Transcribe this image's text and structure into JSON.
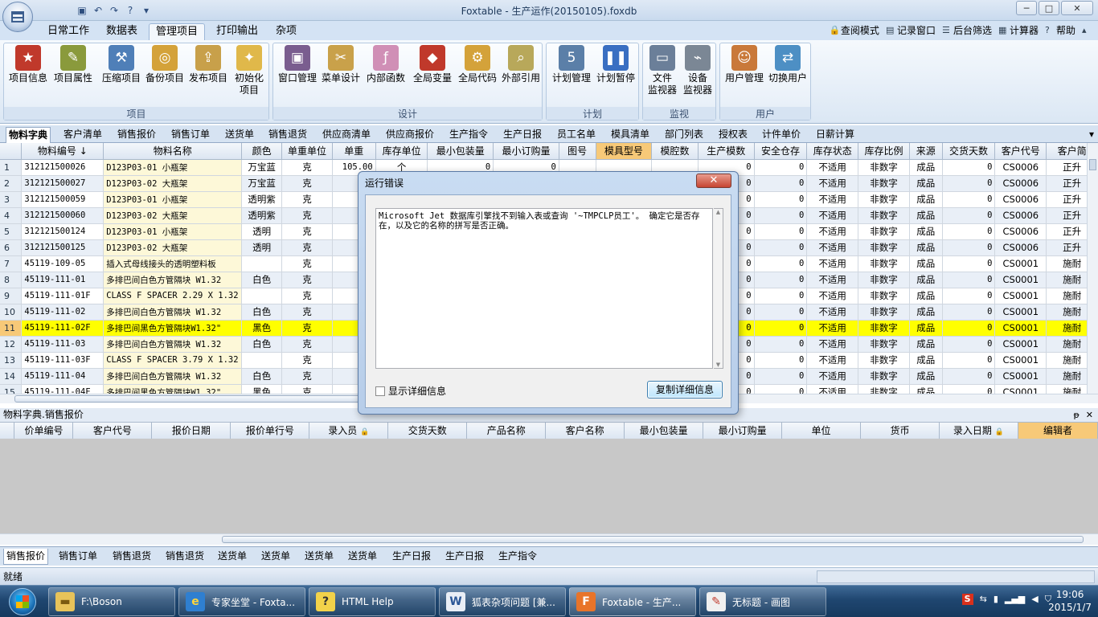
{
  "window": {
    "title": "Foxtable - 生产运作(20150105).foxdb",
    "minimize": "─",
    "maximize": "□",
    "close": "✕"
  },
  "ribbon_tabs": [
    "日常工作",
    "数据表",
    "管理项目",
    "打印输出",
    "杂项"
  ],
  "ribbon_right": [
    "查阅模式",
    "记录窗口",
    "后台筛选",
    "计算器",
    "帮助"
  ],
  "ribbon_groups": [
    {
      "label": "项目",
      "buttons": [
        "项目信息",
        "项目属性",
        "压缩项目",
        "备份项目",
        "发布项目",
        "初始化\n项目"
      ]
    },
    {
      "label": "设计",
      "buttons": [
        "窗口管理",
        "菜单设计",
        "内部函数",
        "全局变量",
        "全局代码",
        "外部引用"
      ]
    },
    {
      "label": "计划",
      "buttons": [
        "计划管理",
        "计划暂停"
      ]
    },
    {
      "label": "监视",
      "buttons": [
        "文件\n监视器",
        "设备\n监视器"
      ]
    },
    {
      "label": "用户",
      "buttons": [
        "用户管理",
        "切换用户"
      ]
    }
  ],
  "table_tabs": [
    "物料字典",
    "客户清单",
    "销售报价",
    "销售订单",
    "送货单",
    "销售退货",
    "供应商清单",
    "供应商报价",
    "生产指令",
    "生产日报",
    "员工名单",
    "模具清单",
    "部门列表",
    "授权表",
    "计件单价",
    "日薪计算"
  ],
  "grid": {
    "columns": [
      "",
      "物料编号",
      "物料名称",
      "颜色",
      "单重单位",
      "单重",
      "库存单位",
      "最小包装量",
      "最小订购量",
      "图号",
      "模具型号",
      "模腔数",
      "生产模数",
      "安全仓存",
      "库存状态",
      "库存比例",
      "来源",
      "交货天数",
      "客户代号",
      "客户简"
    ],
    "sort_marker": "↓",
    "rows": [
      [
        "1",
        "312121500026",
        "D123P03-01 小瓶架",
        "万宝蓝",
        "克",
        "105.00",
        "个",
        "0",
        "0",
        "",
        "",
        "",
        "0",
        "0",
        "不适用",
        "非数字",
        "成品",
        "0",
        "CS0006",
        "正升"
      ],
      [
        "2",
        "312121500027",
        "D123P03-02 大瓶架",
        "万宝蓝",
        "克",
        "185",
        "",
        "",
        "",
        "",
        "",
        "",
        "0",
        "0",
        "不适用",
        "非数字",
        "成品",
        "0",
        "CS0006",
        "正升"
      ],
      [
        "3",
        "312121500059",
        "D123P03-01 小瓶架",
        "透明紫",
        "克",
        "105",
        "",
        "",
        "",
        "",
        "",
        "",
        "0",
        "0",
        "不适用",
        "非数字",
        "成品",
        "0",
        "CS0006",
        "正升"
      ],
      [
        "4",
        "312121500060",
        "D123P03-02 大瓶架",
        "透明紫",
        "克",
        "185",
        "",
        "",
        "",
        "",
        "",
        "",
        "0",
        "0",
        "不适用",
        "非数字",
        "成品",
        "0",
        "CS0006",
        "正升"
      ],
      [
        "5",
        "312121500124",
        "D123P03-01 小瓶架",
        "透明",
        "克",
        "105",
        "",
        "",
        "",
        "",
        "",
        "",
        "0",
        "0",
        "不适用",
        "非数字",
        "成品",
        "0",
        "CS0006",
        "正升"
      ],
      [
        "6",
        "312121500125",
        "D123P03-02 大瓶架",
        "透明",
        "克",
        "185",
        "",
        "",
        "",
        "",
        "",
        "",
        "0",
        "0",
        "不适用",
        "非数字",
        "成品",
        "0",
        "CS0006",
        "正升"
      ],
      [
        "7",
        "45119-109-05",
        "插入式母线接头的透明塑料板",
        "",
        "克",
        "0",
        "",
        "",
        "",
        "",
        "",
        "",
        "0",
        "0",
        "不适用",
        "非数字",
        "成品",
        "0",
        "CS0001",
        "施耐"
      ],
      [
        "8",
        "45119-111-01",
        "多排巴间白色方管隔块 W1.32",
        "白色",
        "克",
        "0",
        "",
        "",
        "",
        "",
        "",
        "",
        "0",
        "0",
        "不适用",
        "非数字",
        "成品",
        "0",
        "CS0001",
        "施耐"
      ],
      [
        "9",
        "45119-111-01F",
        "CLASS F SPACER 2.29 X 1.32",
        "",
        "克",
        "0",
        "",
        "",
        "",
        "",
        "",
        "",
        "0",
        "0",
        "不适用",
        "非数字",
        "成品",
        "0",
        "CS0001",
        "施耐"
      ],
      [
        "10",
        "45119-111-02",
        "多排巴间白色方管隔块 W1.32",
        "白色",
        "克",
        "0",
        "",
        "",
        "",
        "",
        "",
        "",
        "0",
        "0",
        "不适用",
        "非数字",
        "成品",
        "0",
        "CS0001",
        "施耐"
      ],
      [
        "11",
        "45119-111-02F",
        "多排巴间黑色方管隔块W1.32\"",
        "黑色",
        "克",
        "0",
        "",
        "",
        "",
        "",
        "",
        "",
        "0",
        "0",
        "不适用",
        "非数字",
        "成品",
        "0",
        "CS0001",
        "施耐"
      ],
      [
        "12",
        "45119-111-03",
        "多排巴间白色方管隔块 W1.32",
        "白色",
        "克",
        "0",
        "",
        "",
        "",
        "",
        "",
        "",
        "0",
        "0",
        "不适用",
        "非数字",
        "成品",
        "0",
        "CS0001",
        "施耐"
      ],
      [
        "13",
        "45119-111-03F",
        "CLASS F SPACER 3.79 X 1.32",
        "",
        "克",
        "0",
        "",
        "",
        "",
        "",
        "",
        "",
        "0",
        "0",
        "不适用",
        "非数字",
        "成品",
        "0",
        "CS0001",
        "施耐"
      ],
      [
        "14",
        "45119-111-04",
        "多排巴间白色方管隔块 W1.32",
        "白色",
        "克",
        "0",
        "",
        "",
        "",
        "",
        "",
        "",
        "0",
        "0",
        "不适用",
        "非数字",
        "成品",
        "0",
        "CS0001",
        "施耐"
      ],
      [
        "15",
        "45119-111-04F",
        "多排巴间黑色方管隔块W1.32\"",
        "黑色",
        "克",
        "0",
        "",
        "",
        "",
        "",
        "",
        "",
        "0",
        "0",
        "不适用",
        "非数字",
        "成品",
        "0",
        "CS0001",
        "施耐"
      ]
    ],
    "selected_row": 11
  },
  "sub_panel": {
    "title": "物料字典.销售报价",
    "pin": "ᵽ",
    "close": "✕",
    "columns": [
      "价单编号",
      "客户代号",
      "报价日期",
      "报价单行号",
      "录入员",
      "交货天数",
      "产品名称",
      "客户名称",
      "最小包装量",
      "最小订购量",
      "单位",
      "货币",
      "录入日期",
      "编辑者"
    ]
  },
  "bottom_tabs": [
    "销售报价",
    "销售订单",
    "销售退货",
    "销售退货",
    "送货单",
    "送货单",
    "送货单",
    "送货单",
    "生产日报",
    "生产日报",
    "生产指令"
  ],
  "status": "就绪",
  "dialog": {
    "title": "运行错误",
    "close": "✕",
    "message": "Microsoft Jet 数据库引擎找不到输入表或查询 '~TMPCLP员工'。 确定它是否存在，以及它的名称的拼写是否正确。",
    "checkbox_label": "显示详细信息",
    "copy_button": "复制详细信息"
  },
  "taskbar": {
    "items": [
      "F:\\Boson",
      "专家坐堂 - Foxta...",
      "HTML Help",
      "狐表杂项问题 [兼...",
      "Foxtable - 生产...",
      "无标题 - 画图"
    ],
    "time": "19:06",
    "date": "2015/1/7"
  },
  "colors": {
    "accent": "#f7c978",
    "selected_row": "#ffff00",
    "name_column": "#fdf8d8"
  }
}
